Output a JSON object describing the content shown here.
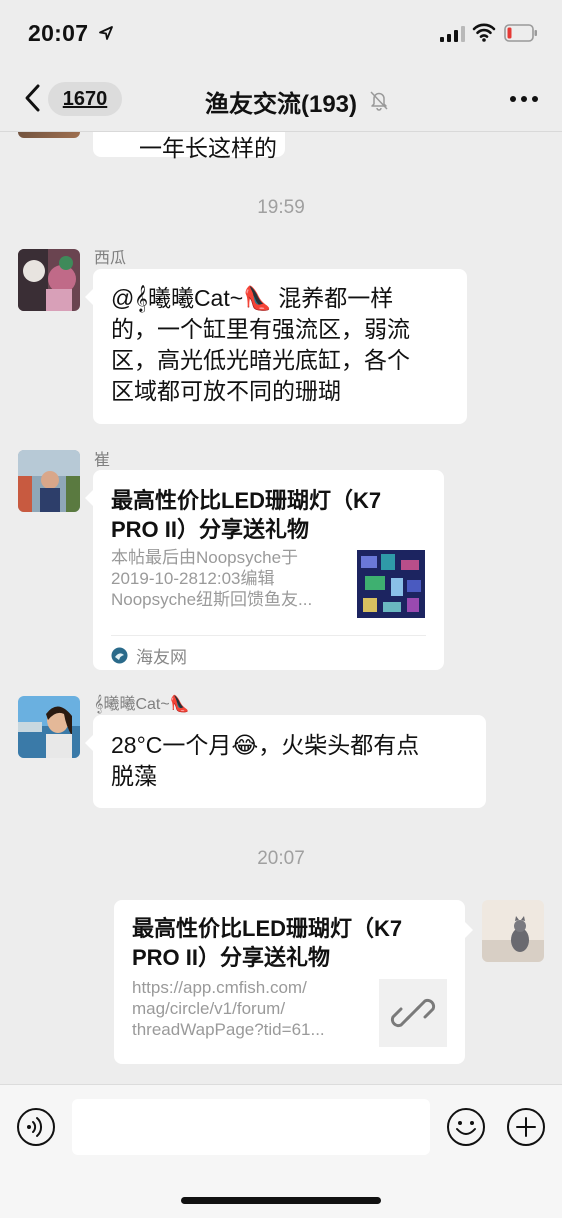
{
  "status_bar": {
    "time": "20:07"
  },
  "nav": {
    "unread_count": "1670",
    "title": "渔友交流(193)"
  },
  "messages": {
    "partial_prev": {
      "text": "一年长这样的"
    },
    "time1": "19:59",
    "msg1": {
      "sender": "西瓜",
      "text_line1": "@𝄞曦曦Cat~👠 混养都一样",
      "text_line2": "的，一个缸里有强流区，弱流",
      "text_line3": "区，高光低光暗光底缸，各个",
      "text_line4": "区域都可放不同的珊瑚"
    },
    "msg2": {
      "sender": "崔",
      "link_title_line1": "最高性价比LED珊瑚灯（K7",
      "link_title_line2": "PRO II）分享送礼物",
      "link_desc": "本帖最后由Noopsyche于\n2019-10-2812:03编辑\nNoopsyche纽斯回馈鱼友...",
      "source": "海友网"
    },
    "msg3": {
      "sender": "𝄞曦曦Cat~👠",
      "text_line1": "28°C一个月😂，火柴头都有点",
      "text_line2": "脱藻"
    },
    "time2": "20:07",
    "msg4": {
      "link_title_line1": "最高性价比LED珊瑚灯（K7",
      "link_title_line2": "PRO II）分享送礼物",
      "link_desc": "https://app.cmfish.com/\nmag/circle/v1/forum/\nthreadWapPage?tid=61..."
    }
  },
  "icons": {
    "back": "chevron-left-icon",
    "mute": "bell-off-icon",
    "more": "more-dots-icon",
    "voice": "voice-icon",
    "emoji": "emoji-icon",
    "plus": "plus-icon",
    "link": "link-icon"
  },
  "colors": {
    "background": "#ededed",
    "bubble": "#ffffff",
    "meta_text": "#a0a0a0",
    "battery_low": "#e53935"
  }
}
